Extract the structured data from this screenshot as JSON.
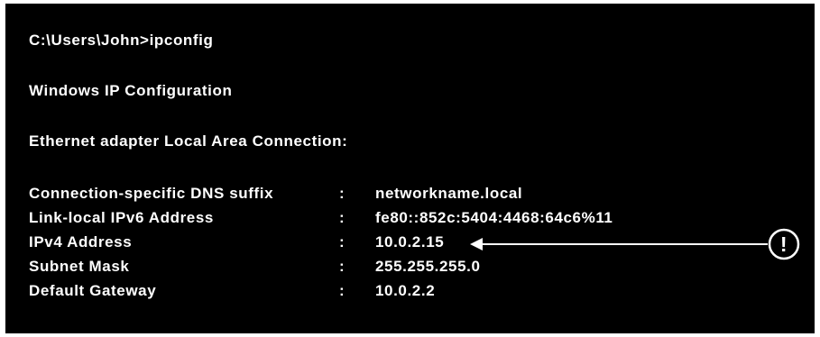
{
  "window": {
    "prompt_line": "C:\\Users\\John>ipconfig",
    "title_line": "Windows IP Configuration",
    "adapter_line": "Ethernet adapter Local Area Connection:"
  },
  "rows": [
    {
      "label": "Connection-specific DNS suffix",
      "sep": ":",
      "value": "networkname.local"
    },
    {
      "label": "Link-local IPv6 Address",
      "sep": ":",
      "value": "fe80::852c:5404:4468:64c6%11"
    },
    {
      "label": "IPv4 Address",
      "sep": ":",
      "value": "10.0.2.15"
    },
    {
      "label": "Subnet Mask",
      "sep": ":",
      "value": "255.255.255.0"
    },
    {
      "label": "Default Gateway",
      "sep": ":",
      "value": "10.0.2.2"
    }
  ],
  "callout": {
    "symbol": "!",
    "icon": "exclamation-circle-icon",
    "points_to": "IPv4 Address"
  },
  "colors": {
    "background": "#000000",
    "text": "#ffffff",
    "frame": "#ffffff"
  }
}
